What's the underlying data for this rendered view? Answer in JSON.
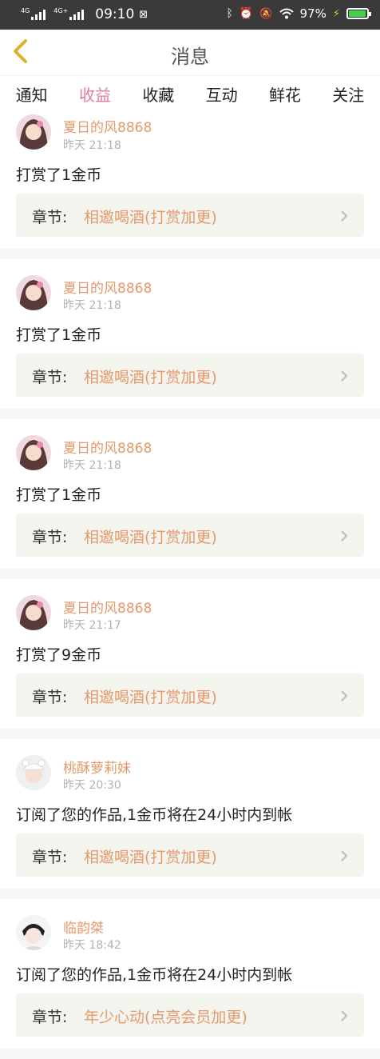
{
  "status_bar": {
    "network1": "4G",
    "network2": "4G+",
    "time": "09:10",
    "battery_percent": "97%",
    "battery_level": 0.97
  },
  "nav": {
    "title": "消息"
  },
  "tabs": [
    {
      "label": "通知"
    },
    {
      "label": "收益"
    },
    {
      "label": "收藏"
    },
    {
      "label": "互动"
    },
    {
      "label": "鲜花"
    },
    {
      "label": "关注"
    }
  ],
  "active_tab": "收益",
  "chapter_prefix": "章节:",
  "items": [
    {
      "username": "夏日的风8868",
      "time": "昨天 21:18",
      "message": "打赏了1金币",
      "chapter": "相邀喝酒(打赏加更)"
    },
    {
      "username": "夏日的风8868",
      "time": "昨天 21:18",
      "message": "打赏了1金币",
      "chapter": "相邀喝酒(打赏加更)"
    },
    {
      "username": "夏日的风8868",
      "time": "昨天 21:18",
      "message": "打赏了1金币",
      "chapter": "相邀喝酒(打赏加更)"
    },
    {
      "username": "夏日的风8868",
      "time": "昨天 21:17",
      "message": "打赏了9金币",
      "chapter": "相邀喝酒(打赏加更)"
    },
    {
      "username": "桃酥萝莉妹",
      "time": "昨天 20:30",
      "message": "订阅了您的作品,1金币将在24小时内到帐",
      "chapter": "相邀喝酒(打赏加更)"
    },
    {
      "username": "临韵桀",
      "time": "昨天 18:42",
      "message": "订阅了您的作品,1金币将在24小时内到帐",
      "chapter": "年少心动(点亮会员加更)"
    }
  ]
}
